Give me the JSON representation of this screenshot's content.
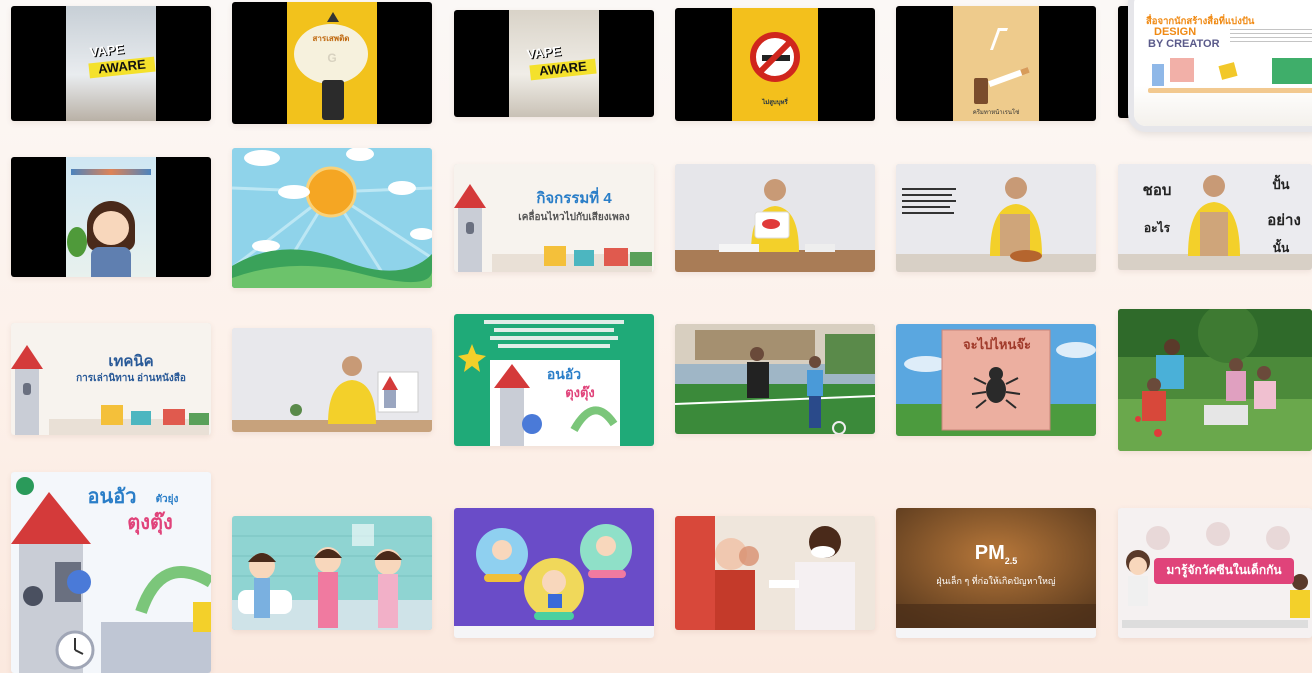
{
  "promo": {
    "headline": "สื่อจากนักสร้างสื่อที่แบ่งปัน",
    "brand_line1": "DESIGN",
    "brand_line2": "BY CREATOR"
  },
  "videos": {
    "v1": {
      "line1": "VAPE",
      "line2": "AWARE"
    },
    "v2": {
      "label": "สารเสพติด",
      "letter": "G"
    },
    "v3": {
      "line1": "VAPE",
      "line2": "AWARE"
    },
    "v4": {
      "caption": "ไม่สูบบุหรี่"
    },
    "v5": {
      "caption": "ครีมทาหน้าเรนโซ่"
    },
    "v7": {
      "title": "กิจกรรมที่ 4",
      "subtitle": "เคลื่อนไหวไปกับเสียงเพลง"
    },
    "v9": {
      "l1": "ชอบ",
      "l2": "อะไร",
      "r1": "ปั้น",
      "r2": "อย่าง",
      "r3": "นั้น"
    },
    "v10": {
      "title": "เทคนิค",
      "subtitle": "การเล่านิทาน อ่านหนังสือ"
    },
    "v11": {
      "title_a": "อนอัว",
      "title_b": "ตุงตุ๊ง"
    },
    "v12": {
      "book_title": "จะไปไหนจ๊ะ"
    },
    "v13": {
      "title_a": "อนอัว",
      "small": "ตัวยุ่ง",
      "title_b": "ตุงตุ๊ง"
    },
    "v14": {
      "title": "PM",
      "sub": "2.5",
      "caption": "ฝุ่นเล็ก ๆ ที่ก่อให้เกิดปัญหาใหญ่"
    },
    "v15": {
      "title": "มารู้จักวัคซีนในเด็กกัน"
    }
  }
}
